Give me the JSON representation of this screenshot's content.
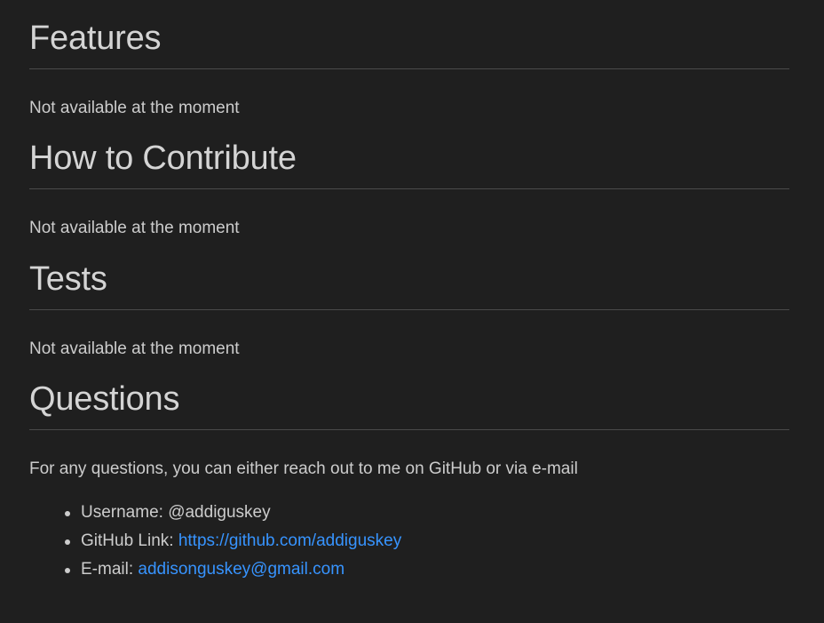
{
  "sections": [
    {
      "heading": "Features",
      "body": "Not available at the moment"
    },
    {
      "heading": "How to Contribute",
      "body": "Not available at the moment"
    },
    {
      "heading": "Tests",
      "body": "Not available at the moment"
    },
    {
      "heading": "Questions",
      "body": "For any questions, you can either reach out to me on GitHub or via e-mail"
    }
  ],
  "contact": {
    "username_label": "Username: ",
    "username_value": "@addiguskey",
    "github_label": "GitHub Link: ",
    "github_url": "https://github.com/addiguskey",
    "email_label": "E-mail: ",
    "email_value": "addisonguskey@gmail.com"
  },
  "colors": {
    "background": "#1f1f1f",
    "text": "#cccccc",
    "link": "#3794ff",
    "rule": "#4a4a4a"
  }
}
